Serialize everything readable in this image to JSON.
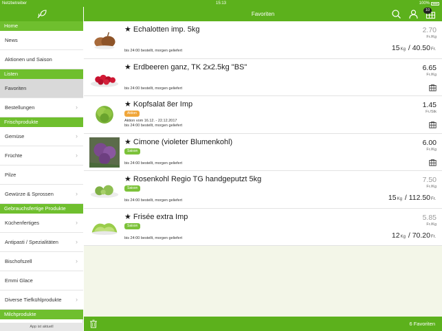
{
  "status_bar": {
    "carrier": "Netzbetreiber",
    "time": "15:13",
    "battery": "100%"
  },
  "sidebar": {
    "footer": "App ist aktuell",
    "groups": [
      {
        "section": "Home",
        "items": [
          "News",
          "Aktionen und Saison"
        ]
      },
      {
        "section": "Listen",
        "items": [
          "Favoriten",
          "Bestellungen"
        ]
      },
      {
        "section": "Frischprodukte",
        "items": [
          "Gemüse",
          "Früchte",
          "Pilze",
          "Gewürze & Sprossen"
        ]
      },
      {
        "section": "Gebrauchsfertige Produkte",
        "items": [
          "Küchenfertiges",
          "Antipasti / Spezialitäten",
          "Bischofszell",
          "Emmi Glace",
          "Diverse Tiefkühlprodukte"
        ]
      },
      {
        "section": "Milchprodukte",
        "items": []
      }
    ]
  },
  "topbar": {
    "title": "Favoriten",
    "basket_count": "10"
  },
  "products": [
    {
      "name": "★ Echalotten imp. 5kg",
      "delivery": "bis 24:00 bestellt, morgen geliefert",
      "price": "2.70",
      "unit": "Fr./Kg",
      "qty": "15",
      "qty_unit": "Kg",
      "total": "/ 40.50",
      "total_unit": "Fr."
    },
    {
      "name": "★ Erdbeeren ganz, TK 2x2.5kg \"BS\"",
      "delivery": "bis 24:00 bestellt, morgen geliefert",
      "price": "6.65",
      "unit": "Fr./Kg"
    },
    {
      "name": "★ Kopfsalat 8er Imp",
      "tag": "Aktion",
      "promo": "Aktion vom 16.12. - 22.12.2017",
      "delivery": "bis 24:00 bestellt, morgen geliefert",
      "price": "1.45",
      "unit": "Fr./Stk"
    },
    {
      "name": "★ Cimone (violeter Blumenkohl)",
      "tag": "Saison",
      "delivery": "bis 24:00 bestellt, morgen geliefert",
      "price": "6.00",
      "unit": "Fr./Kg"
    },
    {
      "name": "★ Rosenkohl Regio TG handgeputzt 5kg",
      "tag": "Saison",
      "delivery": "bis 24:00 bestellt, morgen geliefert",
      "price": "7.50",
      "unit": "Fr./Kg",
      "qty": "15",
      "qty_unit": "Kg",
      "total": "/ 112.50",
      "total_unit": "Fr."
    },
    {
      "name": "★ Frisée extra Imp",
      "tag": "Saison",
      "delivery": "bis 24:00 bestellt, morgen geliefert",
      "price": "5.85",
      "unit": "Fr./Kg",
      "qty": "12",
      "qty_unit": "Kg",
      "total": "/ 70.20",
      "total_unit": "Fr."
    }
  ],
  "bottombar": {
    "count_label": "6 Favoriten"
  },
  "colors": {
    "brand_green": "#5cb11c",
    "section_green": "#6fbf2e",
    "aktion_orange": "#f0a63a",
    "saison_green": "#7cc23a"
  },
  "icons": [
    "leaf-logo-icon",
    "search-icon",
    "user-icon",
    "basket-icon",
    "chevron-right-icon",
    "trash-icon",
    "add-to-cart-icon"
  ]
}
